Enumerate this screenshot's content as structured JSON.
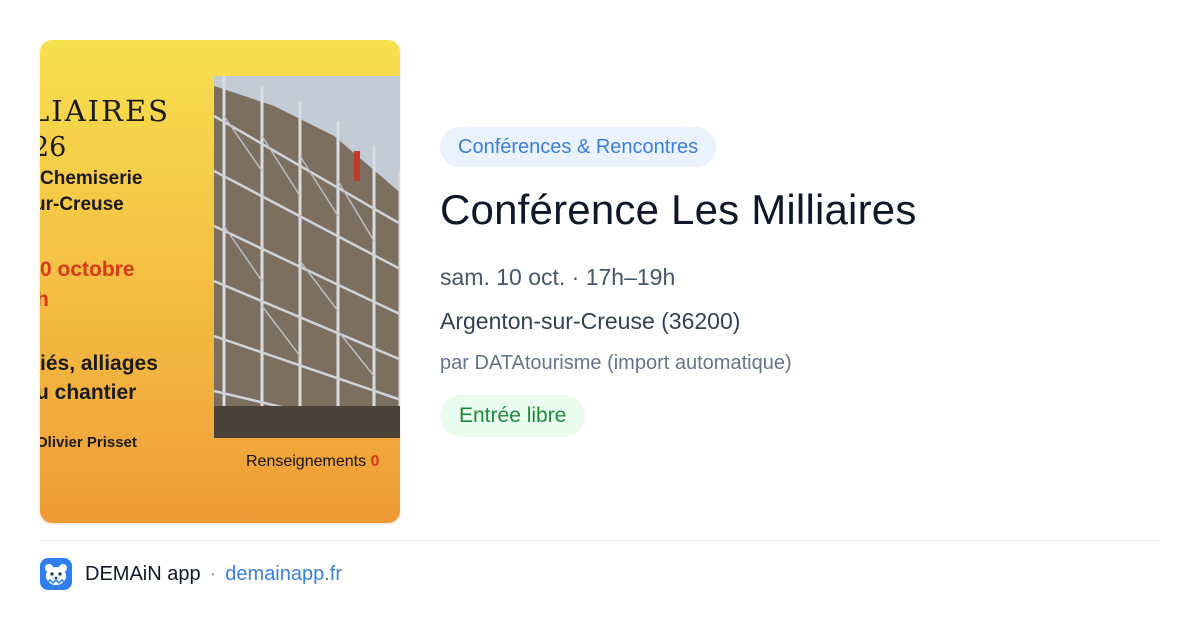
{
  "poster": {
    "title_fragment": "LIAIRES",
    "year_fragment": "26",
    "venue_line1": "Chemiserie",
    "venue_line2": "ur-Creuse",
    "date_fragment": "0 octobre",
    "hour_fragment": "h",
    "topic_line1": "iés, alliages",
    "topic_line2": "u chantier",
    "speaker": "Olivier Prisset",
    "info_label": "Renseignements ",
    "info_number_fragment": "0"
  },
  "event": {
    "category": "Conférences & Rencontres",
    "title": "Conférence Les Milliaires",
    "datetime": "sam. 10 oct. · 17h–19h",
    "location": "Argenton-sur-Creuse (36200)",
    "organizer": "par DATAtourisme (import automatique)",
    "price": "Entrée libre"
  },
  "footer": {
    "app_name": "DEMAiN app",
    "separator": "·",
    "domain": "demainapp.fr",
    "app_icon": "bear-icon"
  },
  "colors": {
    "category_text": "#3b7fd6",
    "category_bg": "#eaf2fd",
    "price_text": "#1f8a3c",
    "price_bg": "#eafbef",
    "poster_accent": "#d53a1a",
    "app_icon_bg": "#2f80ed"
  }
}
